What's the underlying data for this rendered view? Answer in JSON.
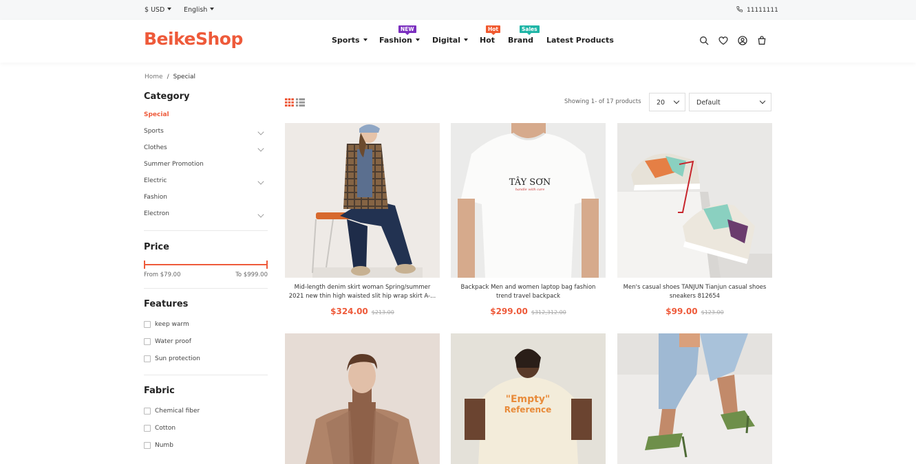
{
  "topbar": {
    "currency": "$ USD",
    "language": "English",
    "phone": "11111111"
  },
  "header": {
    "logo": "BeikeShop",
    "nav": [
      {
        "label": "Sports",
        "dropdown": true,
        "badge": ""
      },
      {
        "label": "Fashion",
        "dropdown": true,
        "badge": "NEW"
      },
      {
        "label": "Digital",
        "dropdown": true,
        "badge": ""
      },
      {
        "label": "Hot",
        "dropdown": false,
        "badge": "Hot"
      },
      {
        "label": "Brand",
        "dropdown": false,
        "badge": "Sales"
      },
      {
        "label": "Latest Products",
        "dropdown": false,
        "badge": ""
      }
    ],
    "icons": [
      "search-icon",
      "heart-icon",
      "user-icon",
      "cart-icon"
    ]
  },
  "breadcrumb": {
    "home": "Home",
    "separator": "/",
    "current": "Special"
  },
  "sidebar": {
    "category_title": "Category",
    "categories": [
      {
        "label": "Special",
        "active": true,
        "expandable": false
      },
      {
        "label": "Sports",
        "active": false,
        "expandable": true
      },
      {
        "label": "Clothes",
        "active": false,
        "expandable": true
      },
      {
        "label": "Summer Promotion",
        "active": false,
        "expandable": false
      },
      {
        "label": "Electric",
        "active": false,
        "expandable": true
      },
      {
        "label": "Fashion",
        "active": false,
        "expandable": false
      },
      {
        "label": "Electron",
        "active": false,
        "expandable": true
      }
    ],
    "price_title": "Price",
    "price_from": "From $79.00",
    "price_to": "To $999.00",
    "features_title": "Features",
    "features": [
      "keep warm",
      "Water proof",
      "Sun protection"
    ],
    "fabric_title": "Fabric",
    "fabrics": [
      "Chemical fiber",
      "Cotton",
      "Numb"
    ]
  },
  "toolbar": {
    "showing": "Showing 1- of 17 products",
    "per_page": "20",
    "sort": "Default"
  },
  "products": [
    {
      "name": "Mid-length denim skirt woman Spring/summer 2021 new thin high waisted slit hip wrap skirt A-...",
      "price": "$324.00",
      "old_price": "$213.00"
    },
    {
      "name": "Backpack Men and women laptop bag fashion trend travel backpack",
      "price": "$299.00",
      "old_price": "$312,312.00"
    },
    {
      "name": "Men's casual shoes TANJUN Tianjun casual shoes sneakers 812654",
      "price": "$99.00",
      "old_price": "$123.00"
    },
    {
      "name": "",
      "price": "",
      "old_price": ""
    },
    {
      "name": "",
      "price": "",
      "old_price": ""
    },
    {
      "name": "",
      "price": "",
      "old_price": ""
    }
  ],
  "product_images": {
    "shirt_print_title": "TÂY SƠN",
    "shirt_print_sub": "handle with care",
    "back_print_line1": "\"Empty\"",
    "back_print_line2": "Reference"
  },
  "colors": {
    "accent": "#ee5a3a",
    "badge_new": "#7b2fbf",
    "badge_hot": "#f0592f",
    "badge_sales": "#1fb5a6"
  }
}
